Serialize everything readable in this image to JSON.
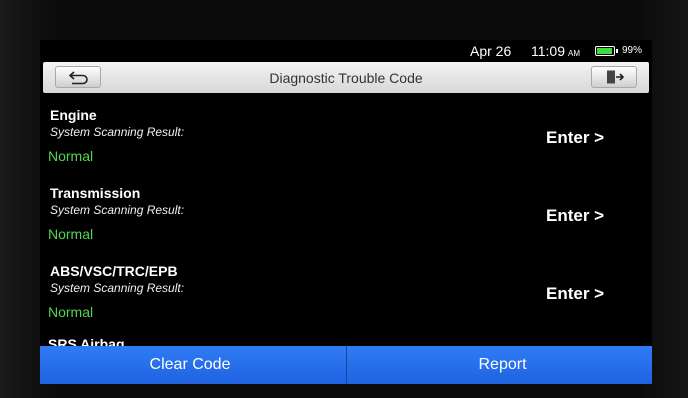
{
  "status_bar": {
    "date": "Apr 26",
    "time": "11:09",
    "ampm": "AM",
    "battery_percent_label": "99%",
    "battery_level": 0.99
  },
  "header": {
    "title": "Diagnostic Trouble Code",
    "back_icon": "return-arrow-icon",
    "exit_icon": "exit-door-icon"
  },
  "systems": [
    {
      "name": "Engine",
      "result_label": "System Scanning Result:",
      "result": "Normal",
      "action": "Enter >"
    },
    {
      "name": "Transmission",
      "result_label": "System Scanning Result:",
      "result": "Normal",
      "action": "Enter >"
    },
    {
      "name": "ABS/VSC/TRC/EPB",
      "result_label": "System Scanning Result:",
      "result": "Normal",
      "action": "Enter >"
    }
  ],
  "partial_next_system": "SRS Airbag",
  "footer": {
    "clear_code": "Clear Code",
    "report": "Report"
  },
  "colors": {
    "status_normal": "#54d454",
    "footer_blue": "#2f7cf5",
    "battery_green": "#3fdc3f"
  }
}
